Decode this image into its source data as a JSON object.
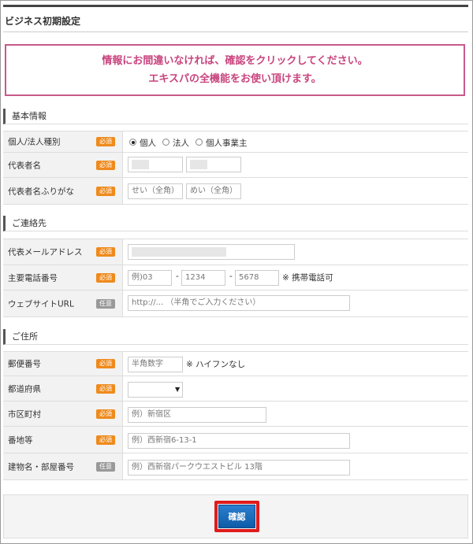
{
  "page": {
    "title": "ビジネス初期設定"
  },
  "notice": {
    "line1": "情報にお間違いなければ、確認をクリックしてください。",
    "line2": "エキスパの全機能をお使い頂けます。"
  },
  "badges": {
    "required": "必須",
    "optional": "任意"
  },
  "sections": {
    "basic": "基本情報",
    "contact": "ご連絡先",
    "address": "ご住所"
  },
  "basic": {
    "type_label": "個人/法人種別",
    "type_options": [
      "個人",
      "法人",
      "個人事業主"
    ],
    "type_selected": "個人",
    "name_label": "代表者名",
    "kana_label": "代表者名ふりがな",
    "kana_first_placeholder": "せい（全角）",
    "kana_last_placeholder": "めい（全角）"
  },
  "contact": {
    "email_label": "代表メールアドレス",
    "phone_label": "主要電話番号",
    "phone_placeholder_1": "例)03",
    "phone_placeholder_2": "1234",
    "phone_placeholder_3": "5678",
    "phone_sep": "-",
    "phone_note": "※ 携帯電話可",
    "website_label": "ウェブサイトURL",
    "website_placeholder": "http://... （半角でご入力ください）"
  },
  "address": {
    "postal_label": "郵便番号",
    "postal_placeholder": "半角数字",
    "postal_note": "※ ハイフンなし",
    "pref_label": "都道府県",
    "pref_value": "",
    "city_label": "市区町村",
    "city_placeholder": "例）新宿区",
    "street_label": "番地等",
    "street_placeholder": "例）西新宿6-13-1",
    "building_label": "建物名・部屋番号",
    "building_placeholder": "例）西新宿パークウエストビル 13階"
  },
  "footer": {
    "confirm_label": "確認"
  }
}
